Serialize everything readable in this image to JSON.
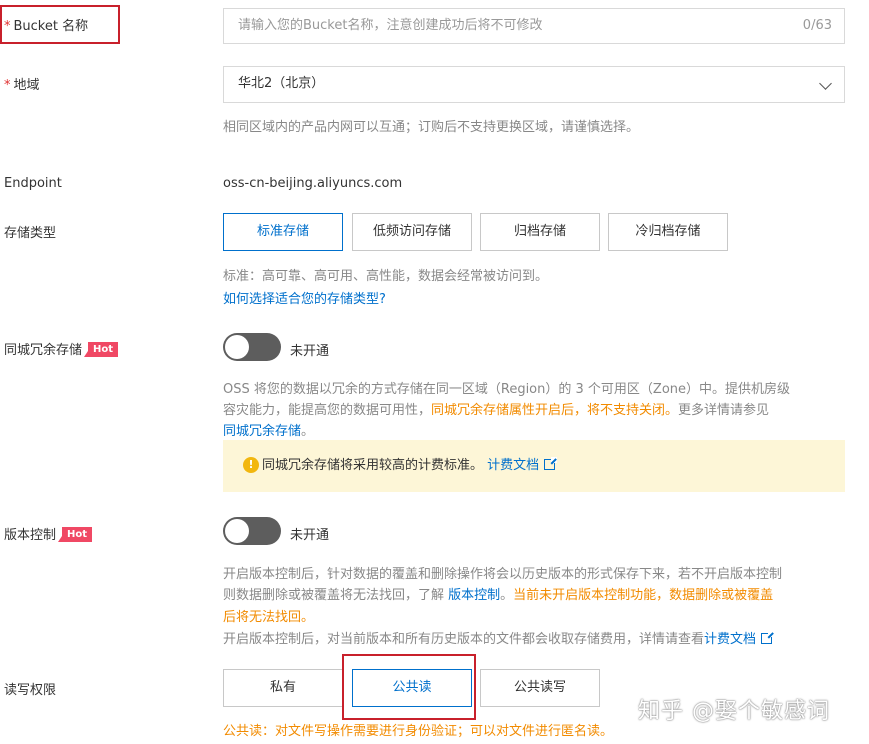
{
  "bucket_name": {
    "required_mark": "*",
    "label": "Bucket 名称",
    "placeholder": "请输入您的Bucket名称，注意创建成功后将不可修改",
    "counter": "0/63"
  },
  "region": {
    "required_mark": "*",
    "label": "地域",
    "value": "华北2（北京）",
    "help": "相同区域内的产品内网可以互通；订购后不支持更换区域，请谨慎选择。"
  },
  "endpoint": {
    "label": "Endpoint",
    "value": "oss-cn-beijing.aliyuncs.com"
  },
  "storage_class": {
    "label": "存储类型",
    "options": [
      "标准存储",
      "低频访问存储",
      "归档存储",
      "冷归档存储"
    ],
    "selected": "标准存储",
    "help": "标准：高可靠、高可用、高性能，数据会经常被访问到。",
    "help_link": "如何选择适合您的存储类型?"
  },
  "zone_redundant": {
    "label": "同城冗余存储",
    "badge": "Hot",
    "status": "未开通",
    "enabled": false,
    "desc_line1": "OSS 将您的数据以冗余的方式存储在同一区域（Region）的 3 个可用区（Zone）中。提供机房级",
    "desc_line2_a": "容灾能力，能提高您的数据可用性，",
    "desc_line2_warn": "同城冗余存储属性开启后，将不支持关闭。",
    "desc_line2_b": "更多详情请参见",
    "desc_link": "同城冗余存储",
    "desc_end": "。",
    "notice_icon": "!",
    "notice_text": "同城冗余存储将采用较高的计费标准。",
    "notice_link": "计费文档"
  },
  "versioning": {
    "label": "版本控制",
    "badge": "Hot",
    "status": "未开通",
    "enabled": false,
    "line1": "开启版本控制后，针对数据的覆盖和删除操作将会以历史版本的形式保存下来，若不开启版本控制",
    "line2_a": "则数据删除或被覆盖将无法找回，了解 ",
    "line2_link": "版本控制",
    "line2_b": "。",
    "line2_warn": "当前未开启版本控制功能，数据删除或被覆盖",
    "line3_warn": "后将无法找回。",
    "line4": "开启版本控制后，对当前版本和所有历史版本的文件都会收取存储费用，详情请查看",
    "line4_link": "计费文档"
  },
  "acl": {
    "label": "读写权限",
    "options": [
      "私有",
      "公共读",
      "公共读写"
    ],
    "selected": "公共读",
    "warning": "公共读：对文件写操作需要进行身份验证；可以对文件进行匿名读。"
  },
  "watermark": "知乎 @娶个敏感词",
  "colors": {
    "accent": "#0070cc",
    "warning": "#f28b00",
    "hot_badge": "#f04864",
    "annotation_box": "#c8202b"
  }
}
